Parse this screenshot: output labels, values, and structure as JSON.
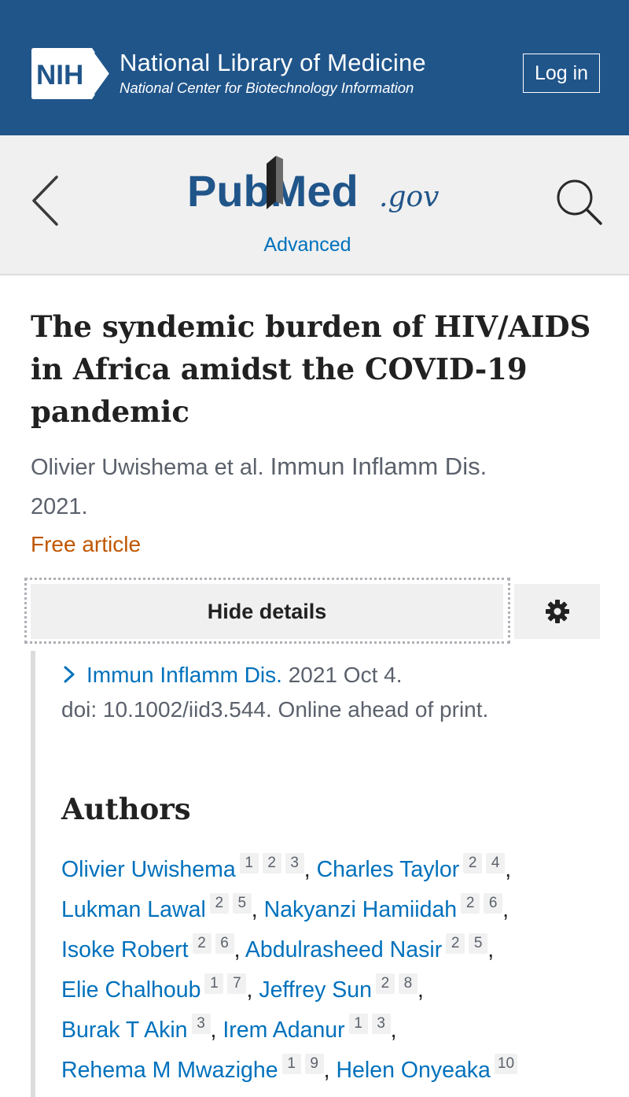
{
  "nih": {
    "logo_text": "NIH",
    "title": "National Library of Medicine",
    "subtitle": "National Center for Biotechnology Information",
    "login_label": "Log in"
  },
  "pubmed": {
    "logo_text": "PubMed",
    "logo_suffix": ".gov",
    "advanced_label": "Advanced"
  },
  "article": {
    "title": "The syndemic burden of HIV/AIDS in Africa amidst the COVID-19 pandemic",
    "citation_authors": "Olivier Uwishema et al.",
    "citation_journal": "Immun Inflamm Dis.",
    "citation_year": "2021.",
    "free_label": "Free article",
    "details_button": "Hide details",
    "journal_link": "Immun Inflamm Dis.",
    "journal_date": "2021 Oct 4.",
    "doi_line": "doi: 10.1002/iid3.544. Online ahead of print."
  },
  "authors": {
    "heading": "Authors",
    "rows": [
      [
        {
          "name": "Olivier Uwishema",
          "affs": [
            "1",
            "2",
            "3"
          ],
          "sep": ","
        },
        {
          "name": "Charles Taylor",
          "affs": [
            "2",
            "4"
          ],
          "sep": ","
        }
      ],
      [
        {
          "name": "Lukman Lawal",
          "affs": [
            "2",
            "5"
          ],
          "sep": ","
        },
        {
          "name": "Nakyanzi Hamiidah",
          "affs": [
            "2",
            "6"
          ],
          "sep": ","
        }
      ],
      [
        {
          "name": "Isoke Robert",
          "affs": [
            "2",
            "6"
          ],
          "sep": ","
        },
        {
          "name": "Abdulrasheed Nasir",
          "affs": [
            "2",
            "5"
          ],
          "sep": ","
        }
      ],
      [
        {
          "name": "Elie Chalhoub",
          "affs": [
            "1",
            "7"
          ],
          "sep": ","
        },
        {
          "name": "Jeffrey Sun",
          "affs": [
            "2",
            "8"
          ],
          "sep": ","
        }
      ],
      [
        {
          "name": "Burak T Akin",
          "affs": [
            "3"
          ],
          "sep": ","
        },
        {
          "name": "Irem Adanur",
          "affs": [
            "1",
            "3"
          ],
          "sep": ","
        }
      ],
      [
        {
          "name": "Rehema M Mwazighe",
          "affs": [
            "1",
            "9"
          ],
          "sep": ","
        },
        {
          "name": "Helen Onyeaka",
          "affs": [
            "10"
          ],
          "sep": ""
        }
      ]
    ]
  },
  "colors": {
    "nih_blue": "#20558a",
    "pubmed_blue": "#20558a",
    "link_blue": "#0071bc",
    "free_orange": "#c05600"
  },
  "icons": [
    "nih-logo",
    "back-chevron-icon",
    "search-icon",
    "gear-icon",
    "chevron-right-icon"
  ]
}
